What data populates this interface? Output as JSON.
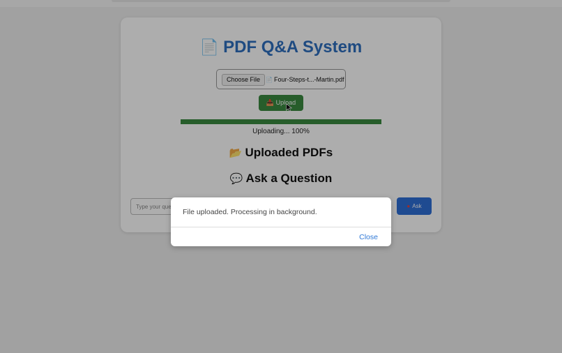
{
  "app": {
    "title_icon": "page-icon",
    "title": "PDF Q&A System"
  },
  "upload": {
    "choose_label": "Choose File",
    "file_icon": "pdf-file-icon",
    "file_name": "Four-Steps-t...-Martin.pdf",
    "upload_icon": "inbox-tray-icon",
    "upload_label": "Upload",
    "progress_percent": 100,
    "progress_text": "Uploading... 100%"
  },
  "sections": {
    "uploaded_icon": "folder-icon",
    "uploaded_heading": "Uploaded PDFs",
    "ask_icon": "speech-bubble-icon",
    "ask_heading": "Ask a Question"
  },
  "question": {
    "placeholder": "Type your question...",
    "ask_icon": "pin-icon",
    "ask_label": "Ask"
  },
  "modal": {
    "message": "File uploaded. Processing in background.",
    "close_label": "Close"
  },
  "colors": {
    "accent_blue": "#2f6fbf",
    "upload_green": "#3a8a40",
    "ask_blue": "#2f6fd6",
    "link_blue": "#2f78d6"
  }
}
